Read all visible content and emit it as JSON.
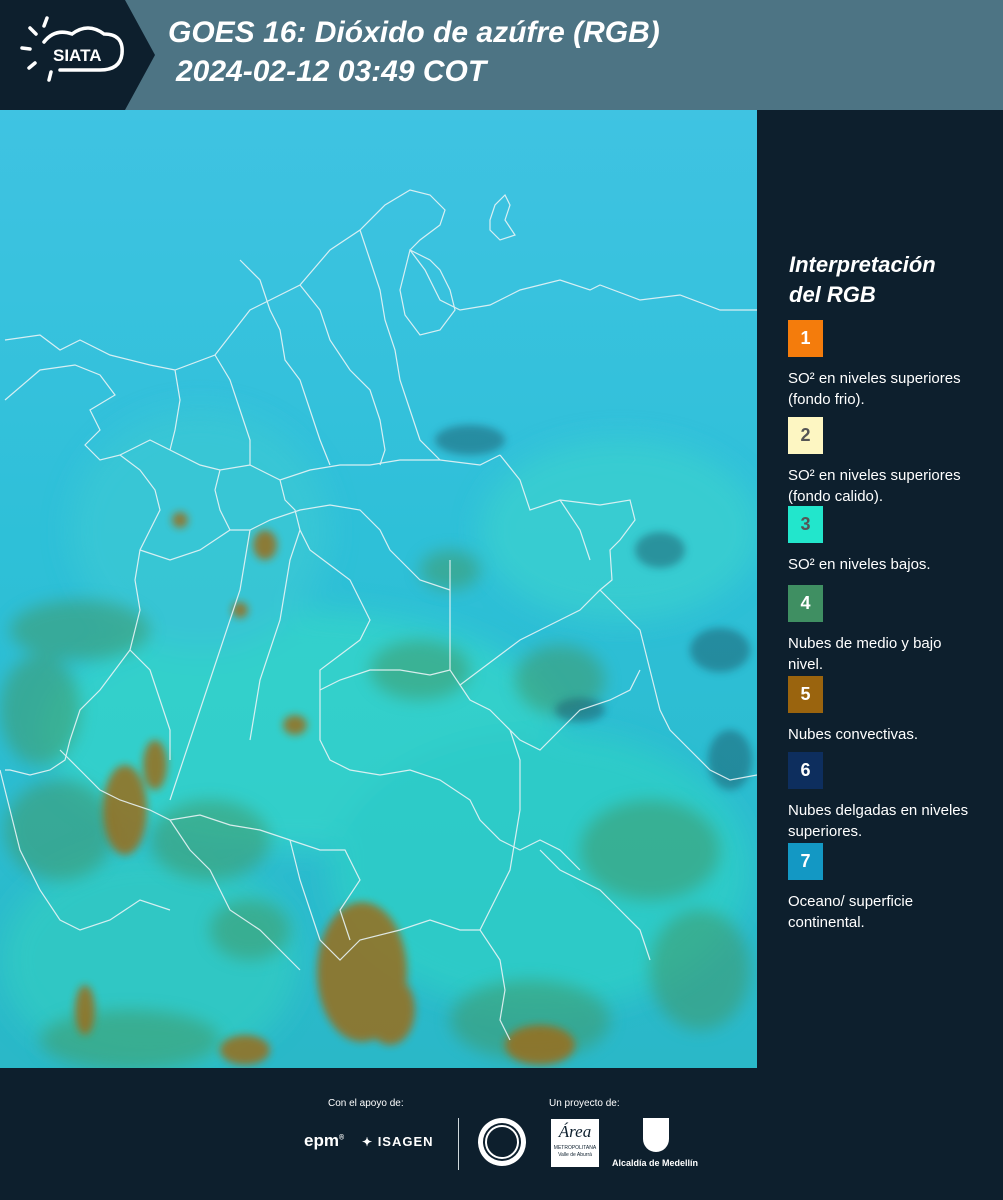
{
  "header": {
    "logo_text": "SIATA",
    "title_line1": "GOES 16: Dióxido de azúfre (RGB)",
    "title_line2": "2024-02-12 03:49 COT"
  },
  "legend": {
    "title_line1": "Interpretación",
    "title_line2": "del RGB",
    "items": [
      {
        "num": "1",
        "color": "#f47c0c",
        "text": "SO² en niveles superiores (fondo frio)."
      },
      {
        "num": "2",
        "color": "#fdf6c2",
        "text": "SO² en niveles superiores (fondo calido)."
      },
      {
        "num": "3",
        "color": "#22e6cc",
        "text": "SO² en niveles bajos."
      },
      {
        "num": "4",
        "color": "#3f8f62",
        "text": "Nubes de medio y bajo nivel."
      },
      {
        "num": "5",
        "color": "#9a640e",
        "text": "Nubes convectivas."
      },
      {
        "num": "6",
        "color": "#0d2e5e",
        "text": "Nubes delgadas en niveles superiores."
      },
      {
        "num": "7",
        "color": "#1398c4",
        "text": "Oceano/ superficie continental."
      }
    ]
  },
  "footer": {
    "support_label": "Con el apoyo de:",
    "project_label": "Un proyecto de:",
    "sponsor_epm": "epm",
    "sponsor_isagen": "ISAGEN",
    "area_logo": "Área",
    "area_sub1": "METROPOLITANA",
    "area_sub2": "Valle de Aburrá",
    "alcaldia": "Alcaldía de Medellín"
  },
  "colors": {
    "background": "#0d1f2d",
    "header": "#4d7484",
    "map_base": "#2cc3dc"
  }
}
